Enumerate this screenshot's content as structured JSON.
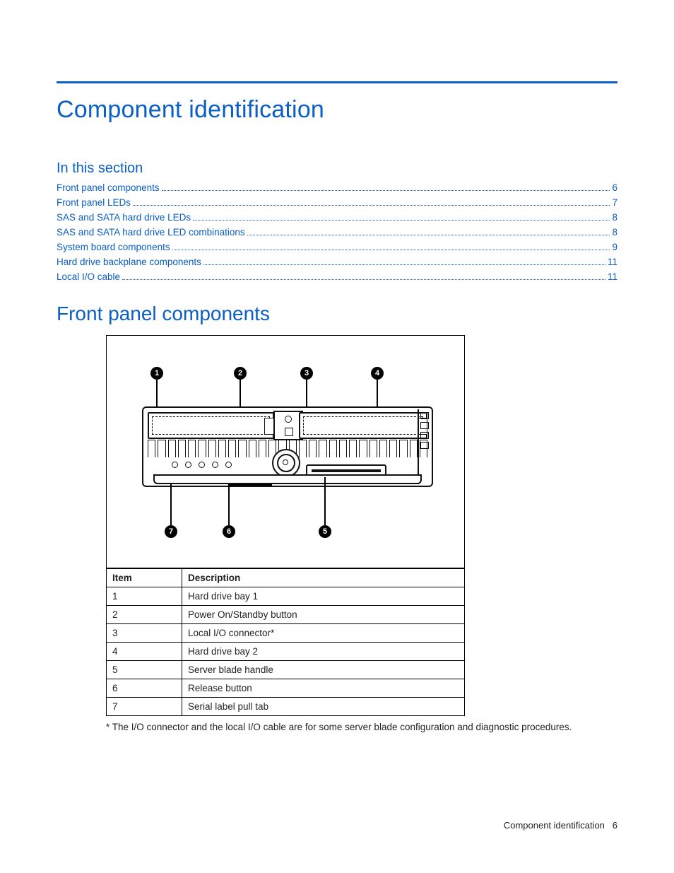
{
  "page_title": "Component identification",
  "in_this_section_heading": "In this section",
  "toc": [
    {
      "label": "Front panel components",
      "page": "6"
    },
    {
      "label": "Front panel LEDs",
      "page": "7"
    },
    {
      "label": "SAS and SATA hard drive LEDs",
      "page": "8"
    },
    {
      "label": "SAS and SATA hard drive LED combinations",
      "page": "8"
    },
    {
      "label": "System board components",
      "page": "9"
    },
    {
      "label": "Hard drive backplane components",
      "page": "11"
    },
    {
      "label": "Local I/O cable",
      "page": "11"
    }
  ],
  "section_heading": "Front panel components",
  "callouts": [
    "1",
    "2",
    "3",
    "4",
    "5",
    "6",
    "7"
  ],
  "table": {
    "headers": {
      "item": "Item",
      "desc": "Description"
    },
    "rows": [
      {
        "item": "1",
        "desc": "Hard drive bay 1"
      },
      {
        "item": "2",
        "desc": "Power On/Standby button"
      },
      {
        "item": "3",
        "desc": "Local I/O connector*"
      },
      {
        "item": "4",
        "desc": "Hard drive bay 2"
      },
      {
        "item": "5",
        "desc": "Server blade handle"
      },
      {
        "item": "6",
        "desc": "Release button"
      },
      {
        "item": "7",
        "desc": "Serial label pull tab"
      }
    ]
  },
  "footnote": "* The I/O connector and the local I/O cable are for some server blade configuration and diagnostic procedures.",
  "footer": {
    "text": "Component identification",
    "page": "6"
  }
}
